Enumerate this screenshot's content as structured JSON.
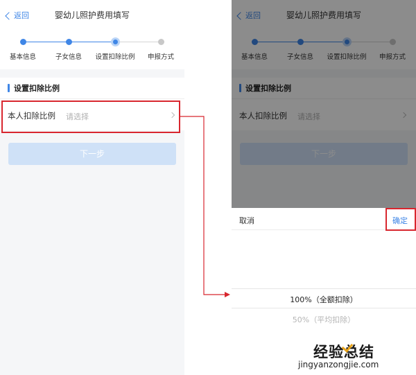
{
  "header": {
    "back_label": "返回",
    "title": "婴幼儿照护费用填写"
  },
  "steps": [
    {
      "label": "基本信息",
      "state": "done"
    },
    {
      "label": "子女信息",
      "state": "done"
    },
    {
      "label": "设置扣除比例",
      "state": "current"
    },
    {
      "label": "申报方式",
      "state": "todo"
    }
  ],
  "section": {
    "title": "设置扣除比例"
  },
  "deduction_row": {
    "label": "本人扣除比例",
    "placeholder": "请选择"
  },
  "next_button": {
    "label": "下一步"
  },
  "picker": {
    "cancel_label": "取消",
    "confirm_label": "确定",
    "options": [
      "100%（全额扣除）",
      "50%（平均扣除）"
    ]
  },
  "watermark": {
    "text": "经验总结",
    "url": "jingyanzongjie.com"
  },
  "colors": {
    "accent": "#3f86e6",
    "highlight": "#d8262e",
    "button_disabled": "#cfe1f7"
  }
}
